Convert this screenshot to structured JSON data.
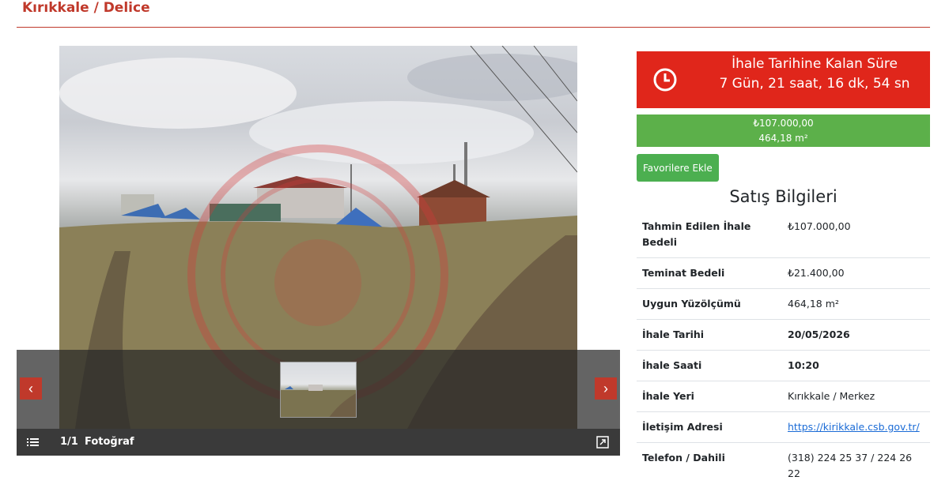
{
  "header": {
    "title": "Kırıkkale / Delice"
  },
  "gallery": {
    "counter": "1/1",
    "label": "Fotoğraf",
    "prev_label": "‹",
    "next_label": "›",
    "icons": {
      "list": "list-icon",
      "expand": "expand-icon",
      "prev": "chevron-left-icon",
      "next": "chevron-right-icon"
    }
  },
  "countdown": {
    "title": "İhale Tarihine Kalan Süre",
    "time": "7 Gün, 21 saat, 16 dk, 54 sn",
    "icon": "clock-icon"
  },
  "price": {
    "amount": "₺107.000,00",
    "area": "464,18 m²"
  },
  "favorite_button": {
    "label": "Favorilere Ekle"
  },
  "sales": {
    "title": "Satış Bilgileri",
    "rows": [
      {
        "label": "Tahmin Edilen İhale Bedeli",
        "value": "₺107.000,00"
      },
      {
        "label": "Teminat Bedeli",
        "value": "₺21.400,00"
      },
      {
        "label": "Uygun Yüzölçümü",
        "value": "464,18 m²"
      },
      {
        "label": "İhale Tarihi",
        "value": "20/05/2026"
      },
      {
        "label": "İhale Saati",
        "value": "10:20"
      },
      {
        "label": "İhale Yeri",
        "value": "Kırıkkale / Merkez"
      },
      {
        "label": "İletişim Adresi",
        "value": "https://kirikkale.csb.gov.tr/"
      },
      {
        "label": "Telefon / Dahili",
        "value": "(318) 224 25 37 / 224 26 22"
      }
    ]
  },
  "colors": {
    "accent_red": "#c0392b",
    "countdown_red": "#e0261b",
    "price_green": "#5cb04a",
    "button_green": "#4caf50",
    "link_blue": "#1a6bd6"
  }
}
